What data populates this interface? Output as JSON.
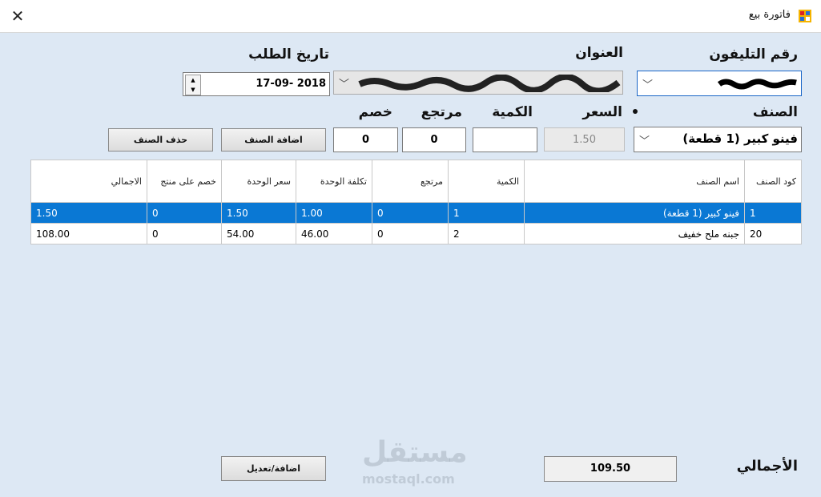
{
  "window": {
    "title": "فاتورة بيع",
    "close_glyph": "✕"
  },
  "labels": {
    "phone": "رقم التليفون",
    "address": "العنوان",
    "order_date": "تاريخ الطلب",
    "item": "الصنف",
    "price": "السعر",
    "quantity": "الكمية",
    "returned": "مرتجع",
    "discount": "خصم",
    "total": "الأجمالي"
  },
  "fields": {
    "order_date": "17-09- 2018",
    "item_selected": "فينو كبير (1 قطعة)",
    "price": "1.50",
    "quantity": "",
    "returned": "0",
    "discount": "0",
    "total": "109.50"
  },
  "buttons": {
    "add_item": "اضافة الصنف",
    "delete_item": "حذف الصنف",
    "add_edit": "اضافة/تعديل"
  },
  "table": {
    "headers": [
      "كود الصنف",
      "اسم الصنف",
      "الكمية",
      "مرتجع",
      "تكلفة الوحدة",
      "سعر الوحدة",
      "خصم على منتج",
      "الاجمالي"
    ],
    "rows": [
      {
        "code": "1",
        "name": "فينو كبير (1 قطعة)",
        "qty": "1",
        "ret": "0",
        "cost": "1.00",
        "unit_price": "1.50",
        "disc": "0",
        "total": "1.50"
      },
      {
        "code": "20",
        "name": "جبنه ملح خفيف",
        "qty": "2",
        "ret": "0",
        "cost": "46.00",
        "unit_price": "54.00",
        "disc": "0",
        "total": "108.00"
      }
    ]
  },
  "watermark": {
    "brand": "مستقل",
    "url": "mostaql.com"
  },
  "colors": {
    "selection": "#0a78d4",
    "background": "#dde8f4"
  }
}
